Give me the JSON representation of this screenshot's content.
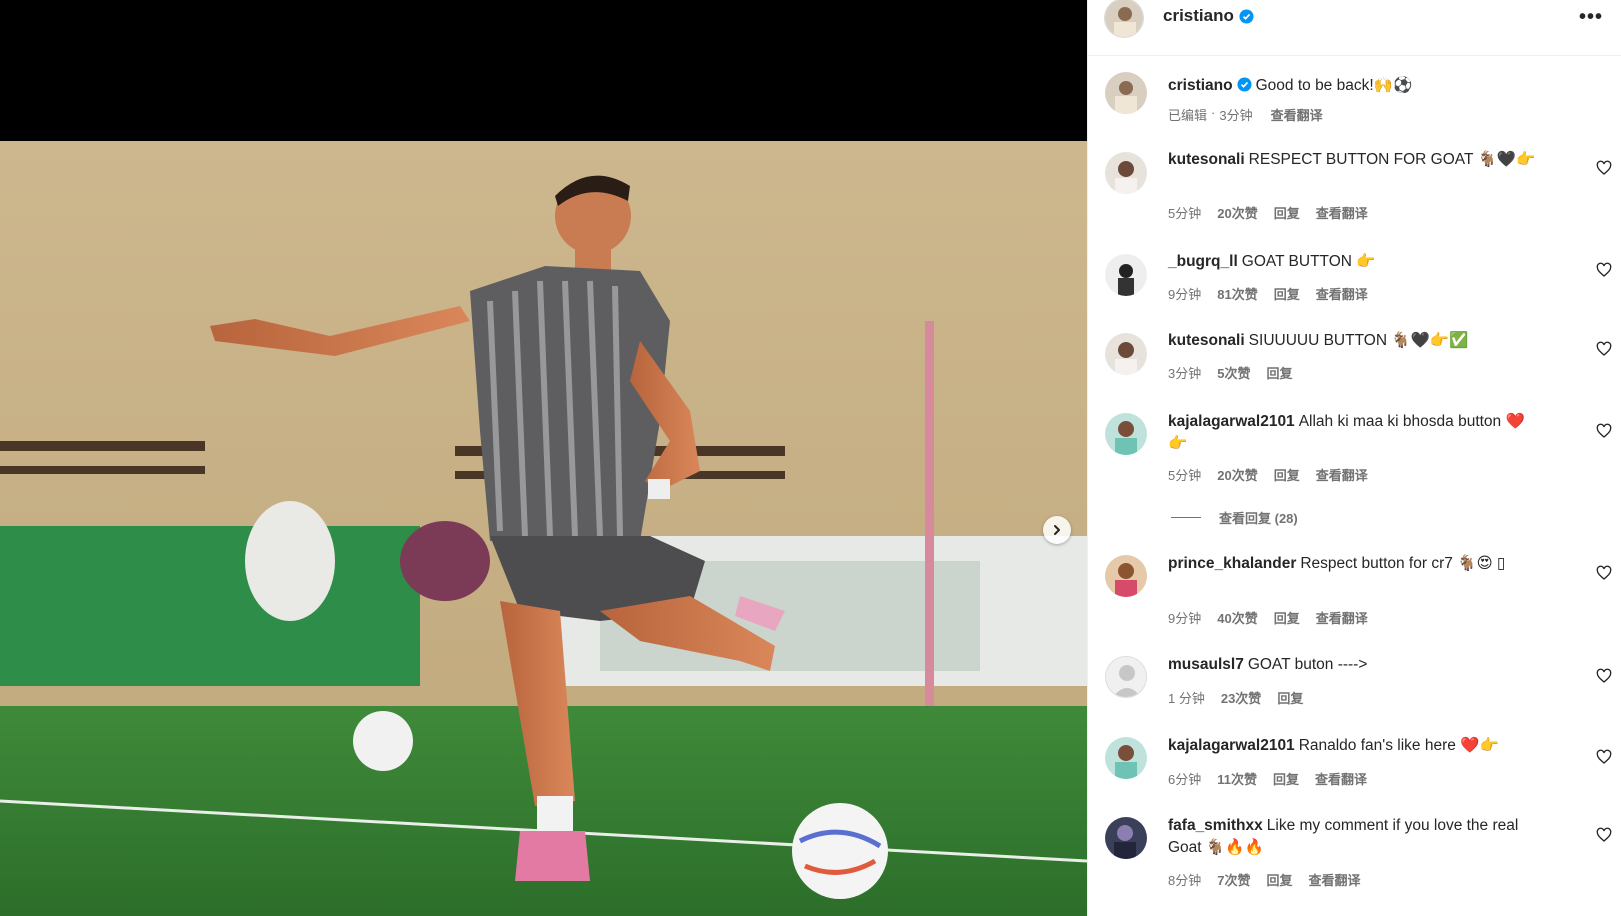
{
  "post": {
    "author": "cristiano",
    "caption": "Good to be back!🙌⚽",
    "edited_label": "已编辑",
    "time": "3分钟",
    "translate_label": "查看翻译"
  },
  "header": {
    "username": "cristiano",
    "more_label": "•••"
  },
  "labels": {
    "reply": "回复",
    "translate": "查看翻译"
  },
  "comments": [
    {
      "user": "kutesonali",
      "text": "RESPECT BUTTON FOR GOAT 🐐🖤👉",
      "time": "5分钟",
      "likes": "20次赞",
      "translate": true
    },
    {
      "user": "_bugrq_ll",
      "text": "GOAT BUTTON 👉",
      "time": "9分钟",
      "likes": "81次赞",
      "translate": true
    },
    {
      "user": "kutesonali",
      "text": "SIUUUUU BUTTON 🐐🖤👉✅",
      "time": "3分钟",
      "likes": "5次赞",
      "translate": false
    },
    {
      "user": "kajalagarwal2101",
      "text": "Allah ki maa ki bhosda button ❤️👉",
      "time": "5分钟",
      "likes": "20次赞",
      "translate": true,
      "view_replies": "查看回复 (28)"
    },
    {
      "user": "prince_khalander",
      "text": "Respect button for cr7 🐐😍 ▯",
      "time": "9分钟",
      "likes": "40次赞",
      "translate": true
    },
    {
      "user": "musaulsl7",
      "text": "GOAT buton ---->",
      "time": "1 分钟",
      "likes": "23次赞",
      "translate": false
    },
    {
      "user": "kajalagarwal2101",
      "text": "Ranaldo fan's like here ❤️👉",
      "time": "6分钟",
      "likes": "11次赞",
      "translate": true
    },
    {
      "user": "fafa_smithxx",
      "text": "Like my comment if you love the real Goat 🐐🔥🔥",
      "time": "8分钟",
      "likes": "7次赞",
      "translate": true
    }
  ],
  "colors": {
    "verified": "#0095f6",
    "meta_text": "#737373",
    "primary_text": "#262626"
  },
  "icons": [
    "verified-icon",
    "heart-icon",
    "more-icon",
    "chevron-right-icon"
  ]
}
